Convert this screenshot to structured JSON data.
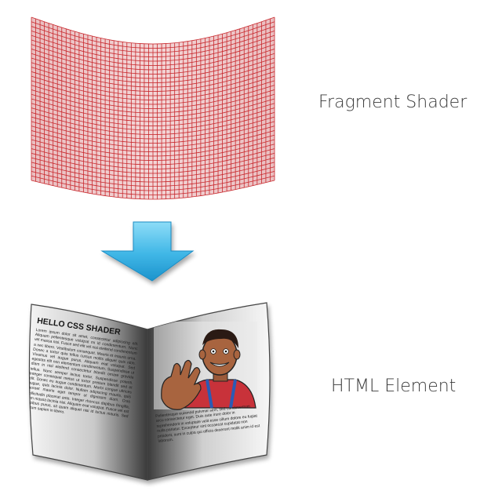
{
  "labels": {
    "fragment_shader": "Fragment Shader",
    "html_element": "HTML Element"
  },
  "page": {
    "heading": "HELLO CSS SHADER",
    "left_column": "Lorem ipsum dolor sit amet, consectetur adipiscing elit. Aliquam pellentesque volutpat mi id condimentum. Nunc vel massa nisi. Fusce sed elit vel nisi eleifend condimentum a nec libero. Vestibulum consequat. Mauris et mauris urna. Donec a tortor quis tellus cursus mollis aliquet quis nibh. Vivamus vel augue purus. Aliquam erat volutpat. Sed egestas elit non elementum condimentum. Suspendisse ut diam in nisl eleifend consectetur blandit ornare gravida tellus. Nunc semper lectus tortor. Suspendisse potenti. Integer consequat metus ut tortor pretium blandit sed et elit. Donec eu augue condimentum. Morbi congue ultrices augue, quis lacinia dolor. Nullam adipiscing mauris, quis laoreet mauris eget tempor ut dignissim diam. Cras sollicitudin placerat ante. Integer rhoncus dapibus fringilla, sem massa lacinia nisi. Aliquam erat volutpat. Fusce vel est dapibus purus, sit quam aliquet nisi id luctus mauris. Sed dictum sapien in libero.",
    "right_column": "Pellentesque euismod pulvinar sem, sed condimentum arcu consectetur eget. Duis aute irure dolor in reprehenderit in voluptate velit esse cillum dolore eu fugiat nulla pariatur. Excepteur sint occaecat cupidatat non proident, sunt in culpa qui officia deserunt mollit anim id est laborum."
  },
  "colors": {
    "mesh_stroke": "#c8282d",
    "mesh_fill": "#c0282d",
    "arrow": "#45bde9",
    "label": "#3a3a3a"
  },
  "icons": {
    "arrow": "down-arrow-icon",
    "illustration": "cartoon-person-waving-icon"
  }
}
